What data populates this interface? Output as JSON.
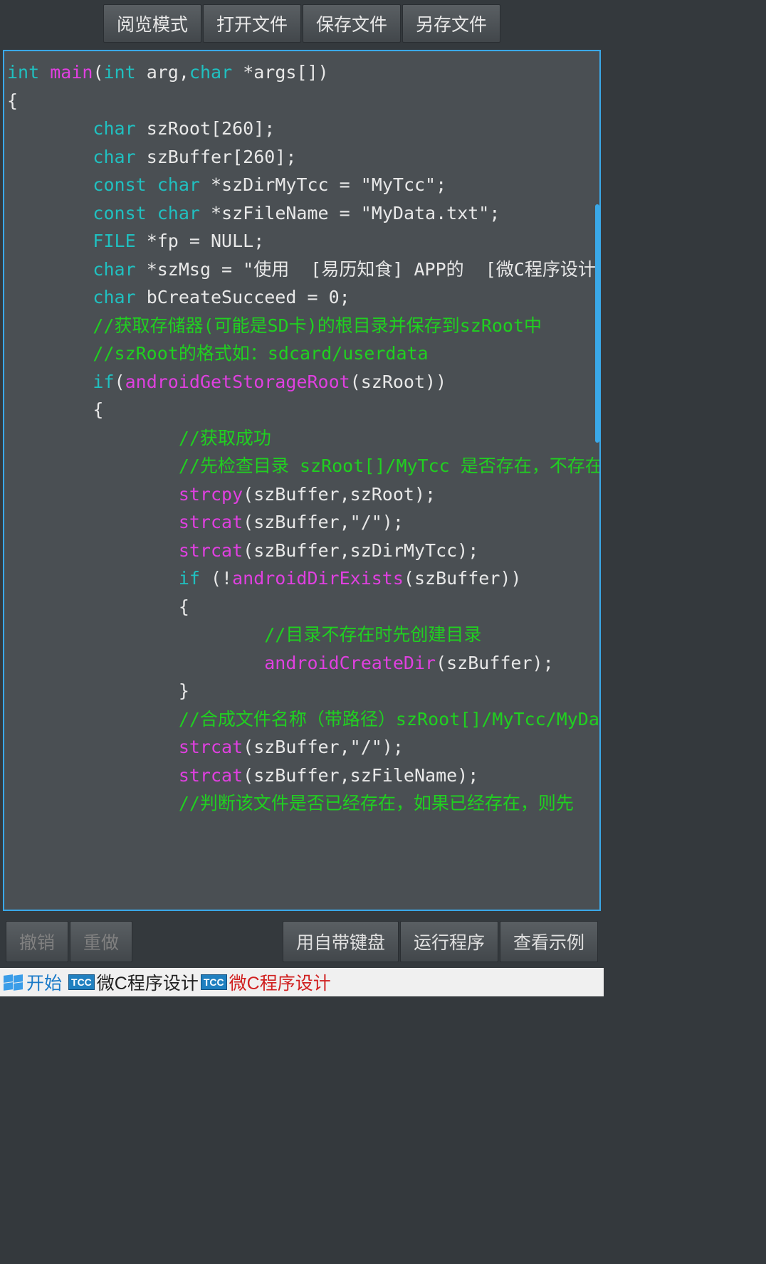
{
  "toolbar": {
    "browse_mode": "阅览模式",
    "open_file": "打开文件",
    "save_file": "保存文件",
    "save_as": "另存文件"
  },
  "code": {
    "lines": [
      {
        "tokens": [
          {
            "t": "kw",
            "v": "int"
          },
          {
            "t": "tx",
            "v": " "
          },
          {
            "t": "fn",
            "v": "main"
          },
          {
            "t": "tx",
            "v": "("
          },
          {
            "t": "kw",
            "v": "int"
          },
          {
            "t": "tx",
            "v": " arg,"
          },
          {
            "t": "kw",
            "v": "char"
          },
          {
            "t": "tx",
            "v": " *args[])"
          }
        ]
      },
      {
        "tokens": [
          {
            "t": "tx",
            "v": "{"
          }
        ]
      },
      {
        "tokens": [
          {
            "t": "tx",
            "v": "        "
          },
          {
            "t": "kw",
            "v": "char"
          },
          {
            "t": "tx",
            "v": " szRoot[260];"
          }
        ]
      },
      {
        "tokens": [
          {
            "t": "tx",
            "v": "        "
          },
          {
            "t": "kw",
            "v": "char"
          },
          {
            "t": "tx",
            "v": " szBuffer[260];"
          }
        ]
      },
      {
        "tokens": [
          {
            "t": "tx",
            "v": "        "
          },
          {
            "t": "kw",
            "v": "const"
          },
          {
            "t": "tx",
            "v": " "
          },
          {
            "t": "kw",
            "v": "char"
          },
          {
            "t": "tx",
            "v": " *szDirMyTcc = \"MyTcc\";"
          }
        ]
      },
      {
        "tokens": [
          {
            "t": "tx",
            "v": "        "
          },
          {
            "t": "kw",
            "v": "const"
          },
          {
            "t": "tx",
            "v": " "
          },
          {
            "t": "kw",
            "v": "char"
          },
          {
            "t": "tx",
            "v": " *szFileName = \"MyData.txt\";"
          }
        ]
      },
      {
        "tokens": [
          {
            "t": "tx",
            "v": "        "
          },
          {
            "t": "kw",
            "v": "FILE"
          },
          {
            "t": "tx",
            "v": " *fp = NULL;"
          }
        ]
      },
      {
        "tokens": [
          {
            "t": "tx",
            "v": "        "
          },
          {
            "t": "kw",
            "v": "char"
          },
          {
            "t": "tx",
            "v": " *szMsg = \"使用  [易历知食] APP的  [微C程序设计"
          }
        ]
      },
      {
        "tokens": [
          {
            "t": "tx",
            "v": "        "
          },
          {
            "t": "kw",
            "v": "char"
          },
          {
            "t": "tx",
            "v": " bCreateSucceed = 0;"
          }
        ]
      },
      {
        "tokens": [
          {
            "t": "tx",
            "v": "        "
          },
          {
            "t": "cm",
            "v": "//获取存储器(可能是SD卡)的根目录并保存到szRoot中"
          }
        ]
      },
      {
        "tokens": [
          {
            "t": "tx",
            "v": "        "
          },
          {
            "t": "cm",
            "v": "//szRoot的格式如：sdcard/userdata"
          }
        ]
      },
      {
        "tokens": [
          {
            "t": "tx",
            "v": "        "
          },
          {
            "t": "kw",
            "v": "if"
          },
          {
            "t": "tx",
            "v": "("
          },
          {
            "t": "fn",
            "v": "androidGetStorageRoot"
          },
          {
            "t": "tx",
            "v": "(szRoot))"
          }
        ]
      },
      {
        "tokens": [
          {
            "t": "tx",
            "v": "        {"
          }
        ]
      },
      {
        "tokens": [
          {
            "t": "tx",
            "v": "                "
          },
          {
            "t": "cm",
            "v": "//获取成功"
          }
        ]
      },
      {
        "tokens": [
          {
            "t": "tx",
            "v": "                "
          },
          {
            "t": "cm",
            "v": "//先检查目录 szRoot[]/MyTcc 是否存在，不存在则"
          }
        ]
      },
      {
        "tokens": [
          {
            "t": "tx",
            "v": "                "
          },
          {
            "t": "fn",
            "v": "strcpy"
          },
          {
            "t": "tx",
            "v": "(szBuffer,szRoot);"
          }
        ]
      },
      {
        "tokens": [
          {
            "t": "tx",
            "v": "                "
          },
          {
            "t": "fn",
            "v": "strcat"
          },
          {
            "t": "tx",
            "v": "(szBuffer,\"/\");"
          }
        ]
      },
      {
        "tokens": [
          {
            "t": "tx",
            "v": "                "
          },
          {
            "t": "fn",
            "v": "strcat"
          },
          {
            "t": "tx",
            "v": "(szBuffer,szDirMyTcc);"
          }
        ]
      },
      {
        "tokens": [
          {
            "t": "tx",
            "v": "                "
          },
          {
            "t": "kw",
            "v": "if"
          },
          {
            "t": "tx",
            "v": " (!"
          },
          {
            "t": "fn",
            "v": "androidDirExists"
          },
          {
            "t": "tx",
            "v": "(szBuffer))"
          }
        ]
      },
      {
        "tokens": [
          {
            "t": "tx",
            "v": "                {"
          }
        ]
      },
      {
        "tokens": [
          {
            "t": "tx",
            "v": "                        "
          },
          {
            "t": "cm",
            "v": "//目录不存在时先创建目录"
          }
        ]
      },
      {
        "tokens": [
          {
            "t": "tx",
            "v": "                        "
          },
          {
            "t": "fn",
            "v": "androidCreateDir"
          },
          {
            "t": "tx",
            "v": "(szBuffer);"
          }
        ]
      },
      {
        "tokens": [
          {
            "t": "tx",
            "v": "                }"
          }
        ]
      },
      {
        "tokens": [
          {
            "t": "tx",
            "v": "                "
          },
          {
            "t": "cm",
            "v": "//合成文件名称（带路径）szRoot[]/MyTcc/MyDa"
          }
        ]
      },
      {
        "tokens": [
          {
            "t": "tx",
            "v": "                "
          },
          {
            "t": "fn",
            "v": "strcat"
          },
          {
            "t": "tx",
            "v": "(szBuffer,\"/\");"
          }
        ]
      },
      {
        "tokens": [
          {
            "t": "tx",
            "v": "                "
          },
          {
            "t": "fn",
            "v": "strcat"
          },
          {
            "t": "tx",
            "v": "(szBuffer,szFileName);"
          }
        ]
      },
      {
        "tokens": [
          {
            "t": "tx",
            "v": "                "
          },
          {
            "t": "cm",
            "v": "//判断该文件是否已经存在，如果已经存在，则先"
          }
        ]
      }
    ]
  },
  "bottom": {
    "undo": "撤销",
    "redo": "重做",
    "keyboard": "用自带键盘",
    "run": "运行程序",
    "examples": "查看示例"
  },
  "taskbar": {
    "start": "开始",
    "tcc_label": "TCC",
    "app1": "微C程序设计",
    "app2": "微C程序设计"
  }
}
